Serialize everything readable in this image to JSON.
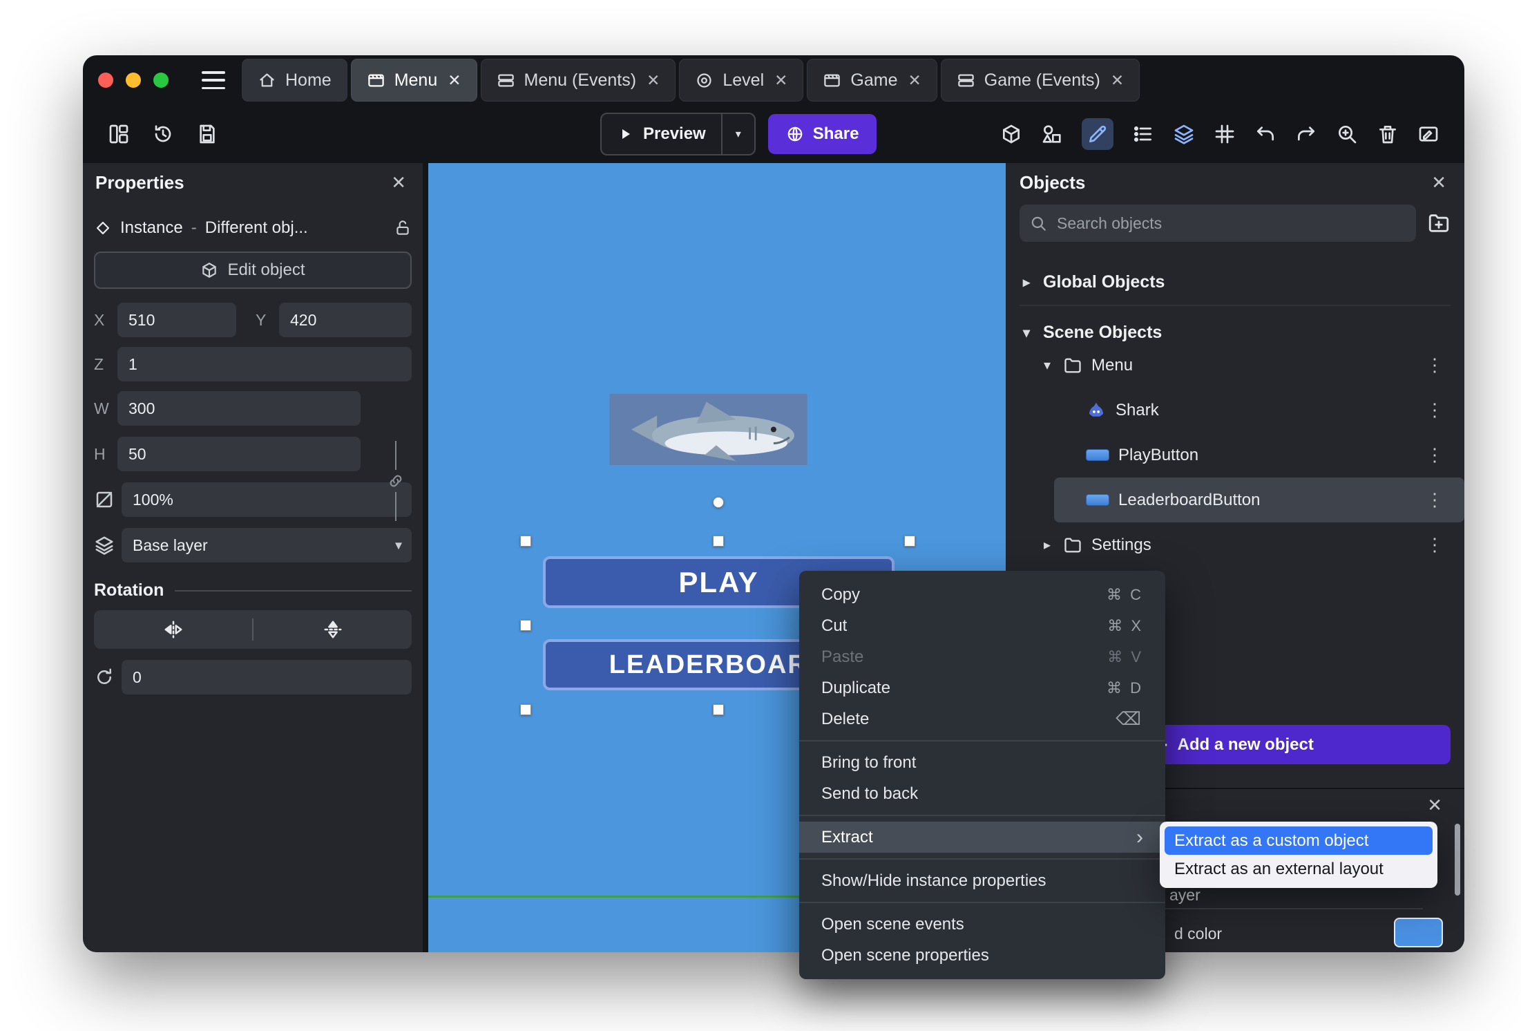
{
  "window": {
    "tabs": [
      {
        "label": "Home"
      },
      {
        "label": "Menu",
        "active": true
      },
      {
        "label": "Menu (Events)"
      },
      {
        "label": "Level"
      },
      {
        "label": "Game"
      },
      {
        "label": "Game (Events)"
      }
    ],
    "toolbar": {
      "preview_label": "Preview",
      "share_label": "Share"
    }
  },
  "properties_panel": {
    "title": "Properties",
    "instance": {
      "type": "Instance",
      "separator": "-",
      "value": "Different obj..."
    },
    "edit_object_label": "Edit object",
    "fields": {
      "x_label": "X",
      "x": "510",
      "y_label": "Y",
      "y": "420",
      "z_label": "Z",
      "z": "1",
      "w_label": "W",
      "w": "300",
      "h_label": "H",
      "h": "50",
      "opacity": "100%",
      "layer": "Base layer"
    },
    "rotation": {
      "title": "Rotation",
      "angle": "0"
    }
  },
  "canvas": {
    "play_label": "PLAY",
    "leaderboard_label": "LEADERBOARD"
  },
  "objects_panel": {
    "title": "Objects",
    "search_placeholder": "Search objects",
    "global_section": "Global Objects",
    "scene_section": "Scene Objects",
    "tree": [
      {
        "label": "Menu",
        "type": "folder",
        "expanded": true
      },
      {
        "label": "Shark",
        "type": "sprite"
      },
      {
        "label": "PlayButton",
        "type": "button"
      },
      {
        "label": "LeaderboardButton",
        "type": "button",
        "selected": true
      },
      {
        "label": "Settings",
        "type": "folder",
        "expanded": false
      }
    ],
    "add_button_label": "Add a new object"
  },
  "bottom_panel": {
    "layer_fragment": "ayer",
    "color_fragment": "d color",
    "swatch_color": "#4a90e2"
  },
  "context_menu": {
    "items": [
      {
        "label": "Copy",
        "shortcut": "⌘ C"
      },
      {
        "label": "Cut",
        "shortcut": "⌘ X"
      },
      {
        "label": "Paste",
        "shortcut": "⌘ V",
        "disabled": true
      },
      {
        "label": "Duplicate",
        "shortcut": "⌘ D"
      },
      {
        "label": "Delete",
        "shortcut": "⌫"
      },
      {
        "label": "Bring to front"
      },
      {
        "label": "Send to back"
      },
      {
        "label": "Extract",
        "submenu": true,
        "highlighted": true
      },
      {
        "label": "Show/Hide instance properties"
      },
      {
        "label": "Open scene events"
      },
      {
        "label": "Open scene properties"
      }
    ]
  },
  "submenu": {
    "items": [
      {
        "label": "Extract as a custom object",
        "highlighted": true
      },
      {
        "label": "Extract as an external layout"
      }
    ]
  },
  "icons": {
    "close": "✕",
    "kebab": "⋮",
    "tri_right": "▸",
    "tri_down": "▾",
    "chevron_down": "▾",
    "plus": "+",
    "submenu_arrow": "›"
  },
  "colors": {
    "canvas_blue": "#4b96dc",
    "share_purple": "#5a2fd9",
    "add_purple": "#4f28cd",
    "game_button_blue": "#3b5cad",
    "submenu_highlight_blue": "#3377f6",
    "swatch_blue": "#4a90e2"
  }
}
